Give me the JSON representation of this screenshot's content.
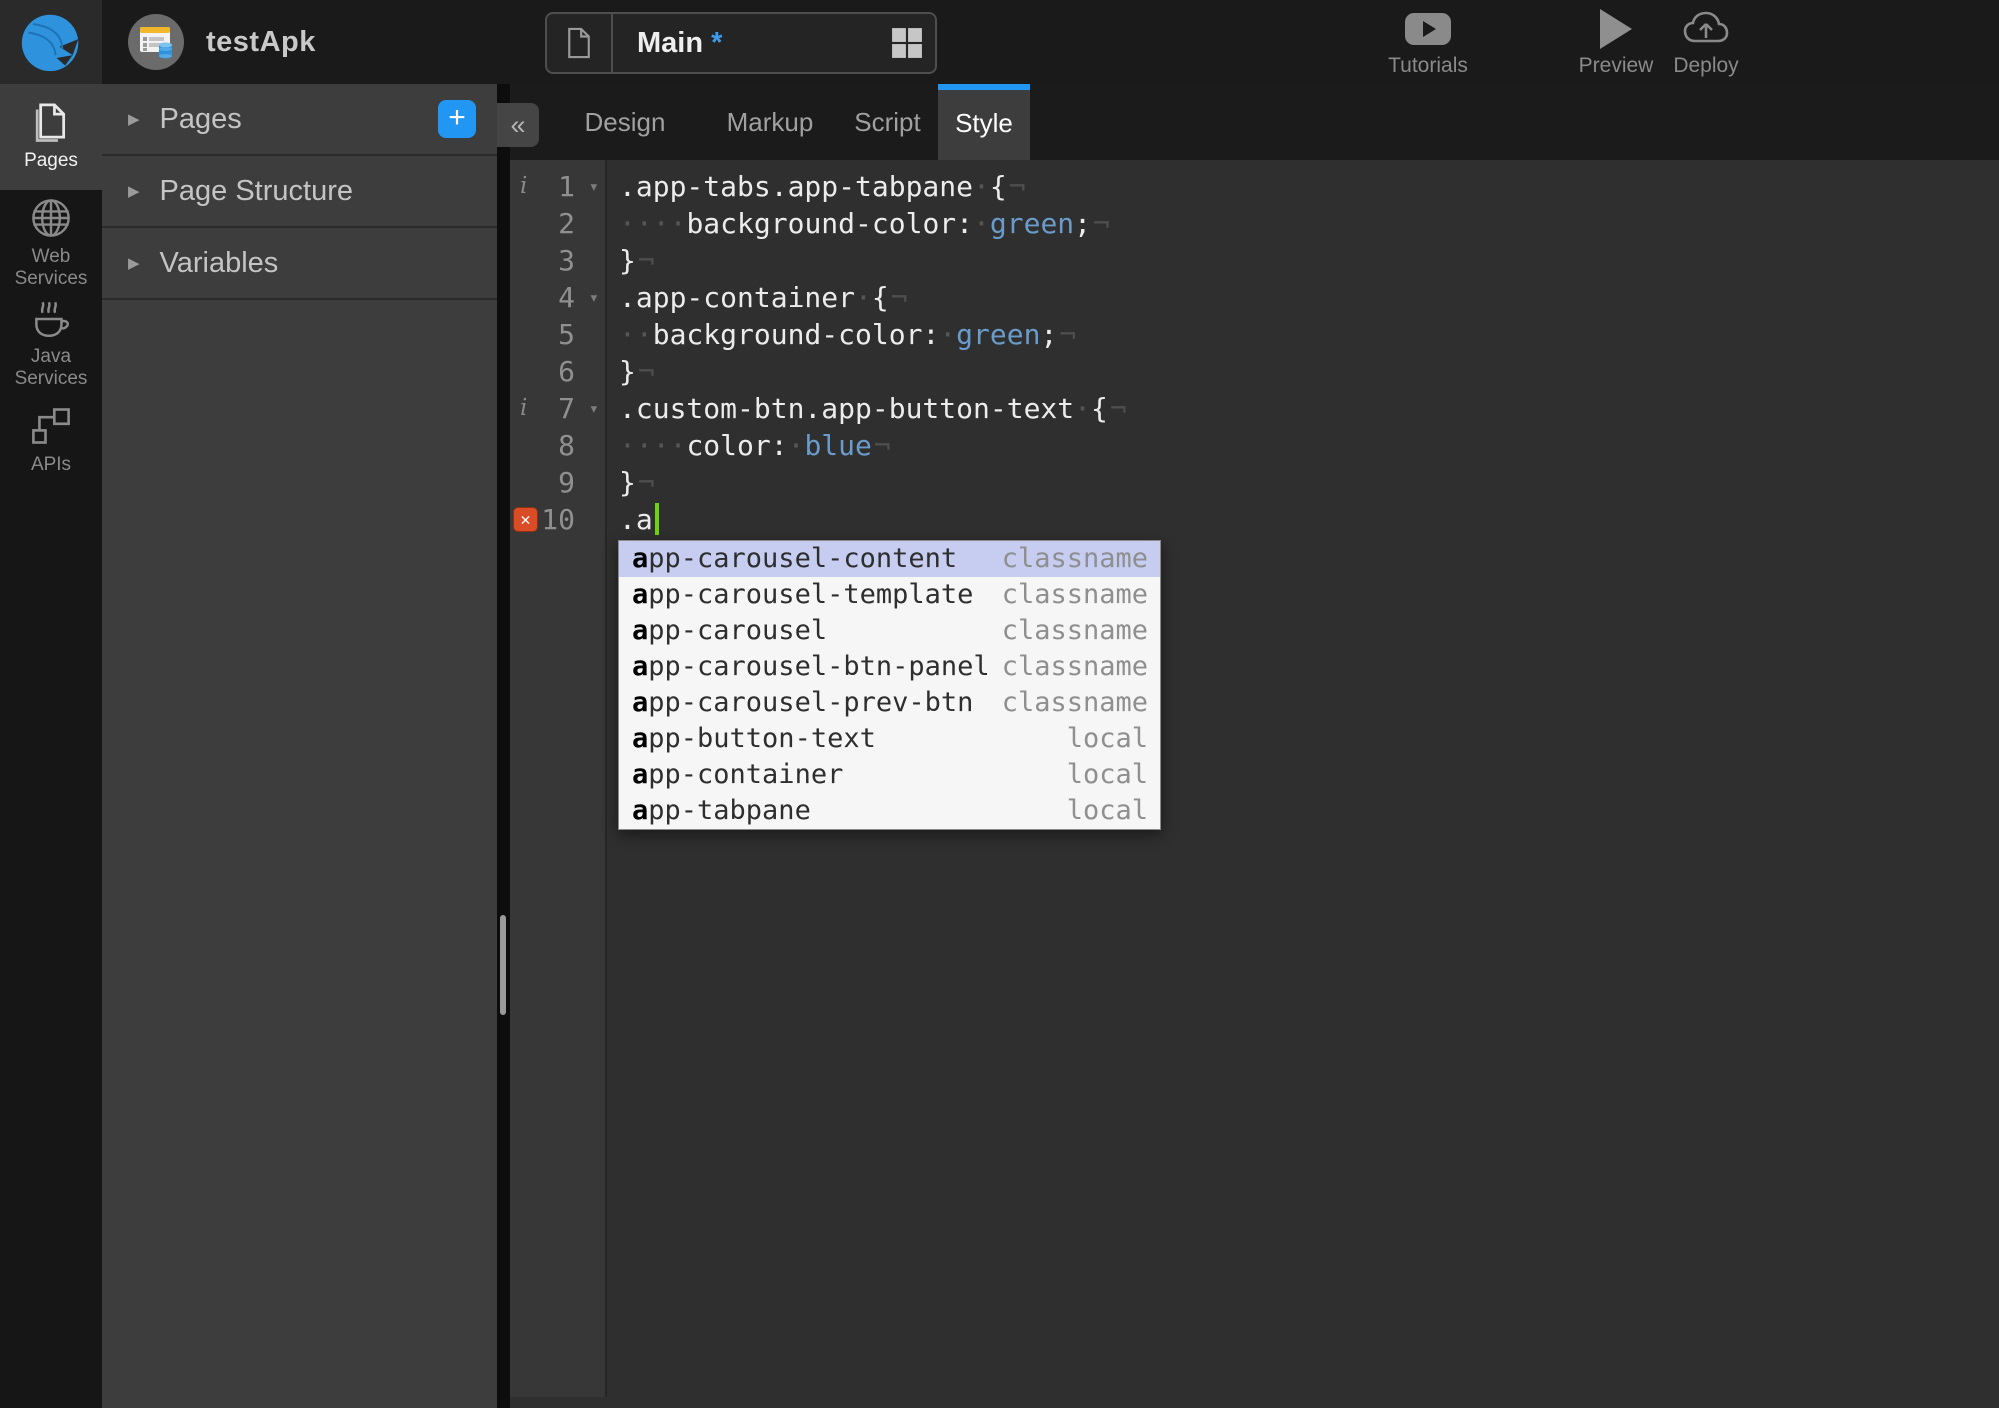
{
  "topbar": {
    "app_name": "testApk",
    "page": {
      "name": "Main",
      "dirty": "*"
    },
    "actions": {
      "tutorials": "Tutorials",
      "preview": "Preview",
      "deploy": "Deploy"
    }
  },
  "sidebar": {
    "items": [
      {
        "label": "Pages",
        "active": true
      },
      {
        "label": "Web Services",
        "active": false
      },
      {
        "label": "Java Services",
        "active": false
      },
      {
        "label": "APIs",
        "active": false
      }
    ]
  },
  "panel": {
    "sections": [
      {
        "label": "Pages"
      },
      {
        "label": "Page Structure"
      },
      {
        "label": "Variables"
      }
    ],
    "add_label": "+",
    "collapse_label": "«"
  },
  "editor_tabs": {
    "items": [
      {
        "label": "Design",
        "active": false
      },
      {
        "label": "Markup",
        "active": false
      },
      {
        "label": "Script",
        "active": false
      },
      {
        "label": "Style",
        "active": true
      }
    ]
  },
  "code": {
    "language": "css",
    "lines": [
      {
        "n": 1,
        "info": true,
        "fold": true,
        "eol": true,
        "segs": [
          {
            "t": ".app-tabs.app-tabpane {"
          }
        ]
      },
      {
        "n": 2,
        "eol": true,
        "segs": [
          {
            "t": "    background-color: "
          },
          {
            "t": "green",
            "v": true
          },
          {
            "t": ";"
          }
        ]
      },
      {
        "n": 3,
        "eol": true,
        "segs": [
          {
            "t": "}"
          }
        ]
      },
      {
        "n": 4,
        "fold": true,
        "eol": true,
        "segs": [
          {
            "t": ".app-container {"
          }
        ]
      },
      {
        "n": 5,
        "eol": true,
        "segs": [
          {
            "t": "  background-color: "
          },
          {
            "t": "green",
            "v": true
          },
          {
            "t": ";"
          }
        ]
      },
      {
        "n": 6,
        "eol": true,
        "segs": [
          {
            "t": "}"
          }
        ]
      },
      {
        "n": 7,
        "info": true,
        "fold": true,
        "eol": true,
        "segs": [
          {
            "t": ".custom-btn.app-button-text {"
          }
        ]
      },
      {
        "n": 8,
        "eol": true,
        "segs": [
          {
            "t": "    color: "
          },
          {
            "t": "blue",
            "v": true
          }
        ]
      },
      {
        "n": 9,
        "eol": true,
        "segs": [
          {
            "t": "}"
          }
        ]
      },
      {
        "n": 10,
        "error": true,
        "caret": true,
        "segs": [
          {
            "t": ".a"
          }
        ]
      }
    ],
    "error_glyph": "✕",
    "info_glyph": "i",
    "fold_glyph": "▾",
    "space_glyph": "·",
    "eol_glyph": "¬"
  },
  "autocomplete": {
    "items": [
      {
        "name": "app-carousel-content",
        "type": "classname",
        "selected": true
      },
      {
        "name": "app-carousel-template",
        "type": "classname",
        "selected": false
      },
      {
        "name": "app-carousel",
        "type": "classname",
        "selected": false
      },
      {
        "name": "app-carousel-btn-panel",
        "type": "classname",
        "selected": false
      },
      {
        "name": "app-carousel-prev-btn",
        "type": "classname",
        "selected": false
      },
      {
        "name": "app-button-text",
        "type": "local",
        "selected": false
      },
      {
        "name": "app-container",
        "type": "local",
        "selected": false
      },
      {
        "name": "app-tabpane",
        "type": "local",
        "selected": false
      }
    ]
  },
  "colors": {
    "accent": "#2196f3",
    "error": "#d94c26",
    "caret": "#70d216",
    "css_value": "#6a9bc9",
    "selected_row": "#c6cdf1"
  }
}
